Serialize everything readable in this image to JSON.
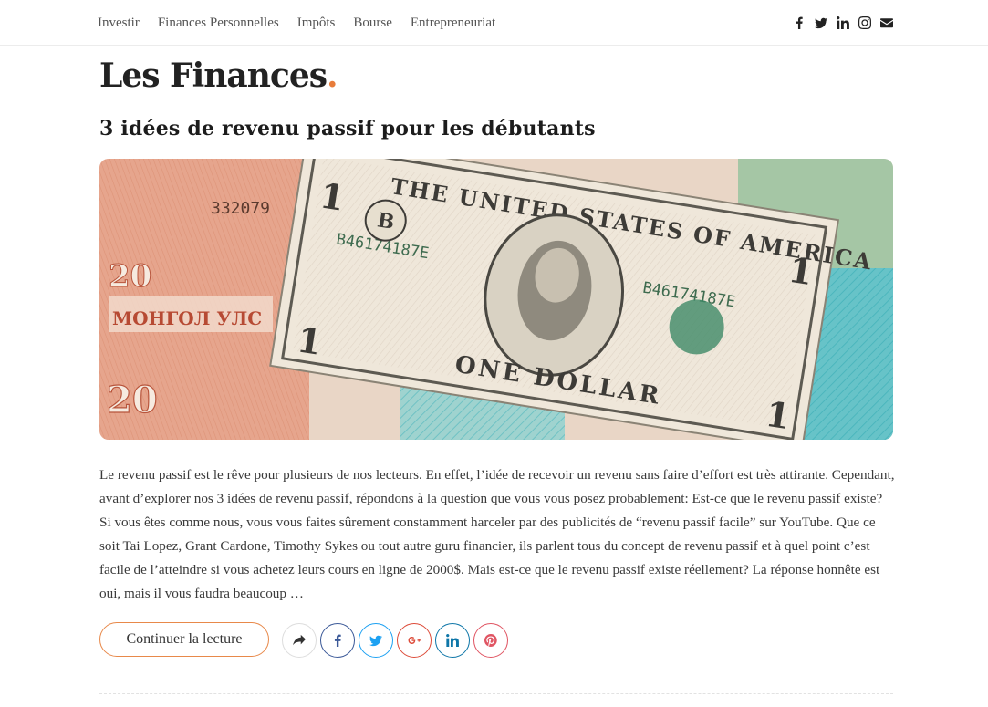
{
  "nav": {
    "items": [
      "Investir",
      "Finances Personnelles",
      "Impôts",
      "Bourse",
      "Entrepreneuriat"
    ]
  },
  "social": {
    "icons": [
      "facebook-icon",
      "twitter-icon",
      "linkedin-icon",
      "instagram-icon",
      "envelope-icon"
    ]
  },
  "logo": {
    "text": "Les Finances",
    "dot": ".",
    "dot_color": "#e87c3a"
  },
  "post": {
    "title": "3 idées de revenu passif pour les débutants",
    "image_alt": "billets de banque",
    "excerpt": "Le revenu passif est le rêve pour plusieurs de nos lecteurs. En effet, l’idée de recevoir un revenu sans faire d’effort est très attirante. Cependant, avant d’explorer nos 3 idées de revenu passif, répondons à la question que vous vous posez probablement: Est-ce que le revenu passif existe? Si vous êtes comme nous, vous vous faites sûrement constamment harceler par des publicités de “revenu passif facile” sur YouTube. Que ce soit Tai Lopez, Grant Cardone, Timothy Sykes ou tout autre guru financier, ils parlent tous du concept de revenu passif et à quel point c’est facile de l’atteindre si vous achetez leurs cours en ligne de 2000$. Mais est-ce que le revenu passif existe réellement? La réponse honnête est oui, mais il vous faudra beaucoup …",
    "read_more": "Continuer la lecture"
  },
  "share": {
    "icons": [
      "share-icon",
      "facebook-icon",
      "twitter-icon",
      "google-plus-icon",
      "linkedin-icon",
      "pinterest-icon"
    ],
    "colors": {
      "facebook": "#3b5998",
      "twitter": "#1da1f2",
      "google_plus": "#dd4b39",
      "linkedin": "#0e76a8",
      "pinterest": "#e05563"
    }
  },
  "colors": {
    "accent": "#e8894a"
  }
}
